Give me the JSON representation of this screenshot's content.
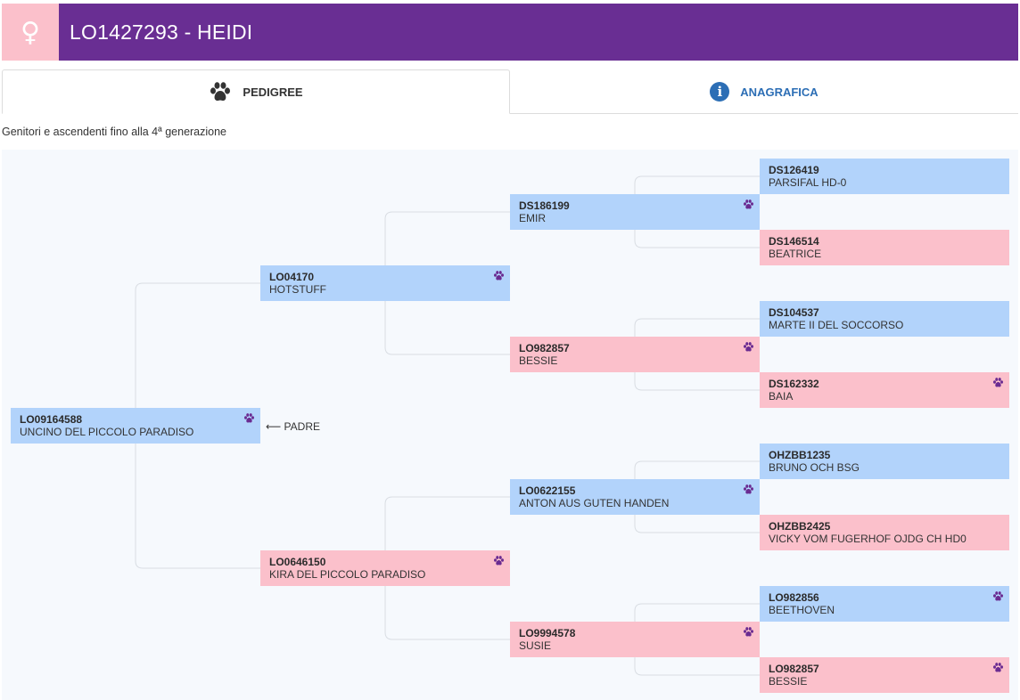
{
  "header": {
    "sex_symbol": "♀",
    "title": "LO1427293 - HEIDI",
    "bg_color": "#692e93",
    "sex_color": "#fbc0cb"
  },
  "tabs": [
    {
      "label": "PEDIGREE",
      "icon": "paw-icon",
      "active": true
    },
    {
      "label": "ANAGRAFICA",
      "icon": "info-icon",
      "active": false
    }
  ],
  "subtitle": "Genitori e ascendenti fino alla 4ª generazione",
  "padre_label": "PADRE",
  "pedigree": {
    "g1": [
      {
        "code": "LO09164588",
        "name": "UNCINO DEL PICCOLO PARADISO",
        "sex": "male",
        "paw": true
      }
    ],
    "g2": [
      {
        "code": "LO04170",
        "name": "HOTSTUFF",
        "sex": "male",
        "paw": true
      },
      {
        "code": "LO0646150",
        "name": "KIRA DEL PICCOLO PARADISO",
        "sex": "female",
        "paw": true
      }
    ],
    "g3": [
      {
        "code": "DS186199",
        "name": "EMIR",
        "sex": "male",
        "paw": true
      },
      {
        "code": "LO982857",
        "name": "BESSIE",
        "sex": "female",
        "paw": true
      },
      {
        "code": "LO0622155",
        "name": "ANTON AUS GUTEN HANDEN",
        "sex": "male",
        "paw": true
      },
      {
        "code": "LO9994578",
        "name": "SUSIE",
        "sex": "female",
        "paw": true
      }
    ],
    "g4": [
      {
        "code": "DS126419",
        "name": "PARSIFAL HD-0",
        "sex": "male",
        "paw": false
      },
      {
        "code": "DS146514",
        "name": "BEATRICE",
        "sex": "female",
        "paw": false
      },
      {
        "code": "DS104537",
        "name": "MARTE II DEL SOCCORSO",
        "sex": "male",
        "paw": false
      },
      {
        "code": "DS162332",
        "name": "BAIA",
        "sex": "female",
        "paw": true
      },
      {
        "code": "OHZBB1235",
        "name": "BRUNO OCH BSG",
        "sex": "male",
        "paw": false
      },
      {
        "code": "OHZBB2425",
        "name": "VICKY VOM FUGERHOF OJDG CH HD0",
        "sex": "female",
        "paw": false
      },
      {
        "code": "LO982856",
        "name": "BEETHOVEN",
        "sex": "male",
        "paw": true
      },
      {
        "code": "LO982857",
        "name": "BESSIE",
        "sex": "female",
        "paw": true
      }
    ]
  },
  "colors": {
    "male": "#b2d3fb",
    "female": "#fbc0cb",
    "paw": "#6a2b91",
    "link": "#2c6eb5"
  }
}
